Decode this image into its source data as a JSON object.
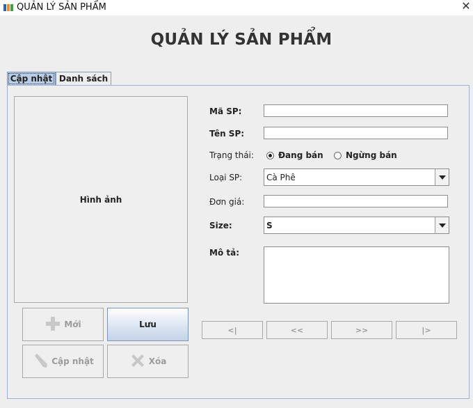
{
  "window": {
    "title": "QUẢN LÝ SẢN PHẨM"
  },
  "header": {
    "title": "QUẢN LÝ SẢN PHẨM"
  },
  "tabs": [
    {
      "label": "Cập nhật",
      "active": true
    },
    {
      "label": "Danh sách",
      "active": false
    }
  ],
  "image_panel": {
    "label": "Hình ảnh"
  },
  "actions": {
    "new": "Mới",
    "save": "Lưu",
    "update": "Cập nhật",
    "delete": "Xóa"
  },
  "form": {
    "ma_sp": {
      "label": "Mã SP:",
      "value": ""
    },
    "ten_sp": {
      "label": "Tên SP:",
      "value": ""
    },
    "trang_thai": {
      "label": "Trạng thái:",
      "options": [
        {
          "label": "Đang bán",
          "selected": true
        },
        {
          "label": "Ngừng bán",
          "selected": false
        }
      ]
    },
    "loai_sp": {
      "label": "Loại SP:",
      "value": "Cà Phê"
    },
    "don_gia": {
      "label": "Đơn giá:",
      "value": ""
    },
    "size": {
      "label": "Size:",
      "value": "S"
    },
    "mo_ta": {
      "label": "Mô tả:",
      "value": ""
    }
  },
  "navigation": {
    "first": "<|",
    "prev": "<<",
    "next": ">>",
    "last": "|>"
  },
  "colors": {
    "tab_active": "#b9cde6",
    "button_primary": "#c4d3e8",
    "panel_border": "#9db1cf"
  },
  "icons": [
    "fpt-logo-icon",
    "close-icon",
    "plus-icon",
    "pencil-icon",
    "x-icon",
    "dropdown-arrow-icon"
  ]
}
